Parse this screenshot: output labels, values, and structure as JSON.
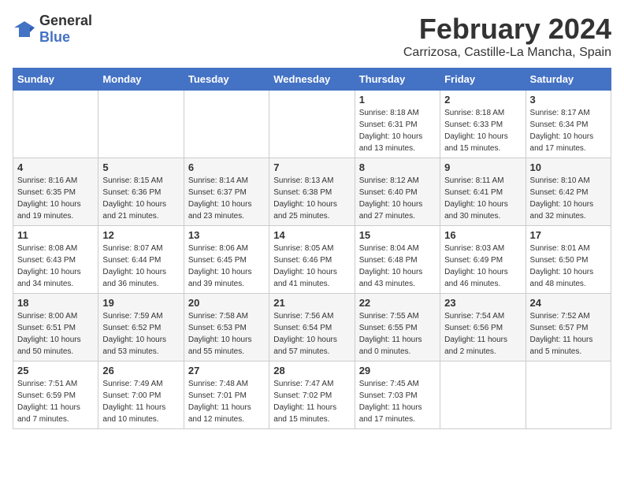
{
  "logo": {
    "text_general": "General",
    "text_blue": "Blue"
  },
  "title": "February 2024",
  "subtitle": "Carrizosa, Castille-La Mancha, Spain",
  "headers": [
    "Sunday",
    "Monday",
    "Tuesday",
    "Wednesday",
    "Thursday",
    "Friday",
    "Saturday"
  ],
  "weeks": [
    [
      {
        "day": "",
        "info": ""
      },
      {
        "day": "",
        "info": ""
      },
      {
        "day": "",
        "info": ""
      },
      {
        "day": "",
        "info": ""
      },
      {
        "day": "1",
        "info": "Sunrise: 8:18 AM\nSunset: 6:31 PM\nDaylight: 10 hours\nand 13 minutes."
      },
      {
        "day": "2",
        "info": "Sunrise: 8:18 AM\nSunset: 6:33 PM\nDaylight: 10 hours\nand 15 minutes."
      },
      {
        "day": "3",
        "info": "Sunrise: 8:17 AM\nSunset: 6:34 PM\nDaylight: 10 hours\nand 17 minutes."
      }
    ],
    [
      {
        "day": "4",
        "info": "Sunrise: 8:16 AM\nSunset: 6:35 PM\nDaylight: 10 hours\nand 19 minutes."
      },
      {
        "day": "5",
        "info": "Sunrise: 8:15 AM\nSunset: 6:36 PM\nDaylight: 10 hours\nand 21 minutes."
      },
      {
        "day": "6",
        "info": "Sunrise: 8:14 AM\nSunset: 6:37 PM\nDaylight: 10 hours\nand 23 minutes."
      },
      {
        "day": "7",
        "info": "Sunrise: 8:13 AM\nSunset: 6:38 PM\nDaylight: 10 hours\nand 25 minutes."
      },
      {
        "day": "8",
        "info": "Sunrise: 8:12 AM\nSunset: 6:40 PM\nDaylight: 10 hours\nand 27 minutes."
      },
      {
        "day": "9",
        "info": "Sunrise: 8:11 AM\nSunset: 6:41 PM\nDaylight: 10 hours\nand 30 minutes."
      },
      {
        "day": "10",
        "info": "Sunrise: 8:10 AM\nSunset: 6:42 PM\nDaylight: 10 hours\nand 32 minutes."
      }
    ],
    [
      {
        "day": "11",
        "info": "Sunrise: 8:08 AM\nSunset: 6:43 PM\nDaylight: 10 hours\nand 34 minutes."
      },
      {
        "day": "12",
        "info": "Sunrise: 8:07 AM\nSunset: 6:44 PM\nDaylight: 10 hours\nand 36 minutes."
      },
      {
        "day": "13",
        "info": "Sunrise: 8:06 AM\nSunset: 6:45 PM\nDaylight: 10 hours\nand 39 minutes."
      },
      {
        "day": "14",
        "info": "Sunrise: 8:05 AM\nSunset: 6:46 PM\nDaylight: 10 hours\nand 41 minutes."
      },
      {
        "day": "15",
        "info": "Sunrise: 8:04 AM\nSunset: 6:48 PM\nDaylight: 10 hours\nand 43 minutes."
      },
      {
        "day": "16",
        "info": "Sunrise: 8:03 AM\nSunset: 6:49 PM\nDaylight: 10 hours\nand 46 minutes."
      },
      {
        "day": "17",
        "info": "Sunrise: 8:01 AM\nSunset: 6:50 PM\nDaylight: 10 hours\nand 48 minutes."
      }
    ],
    [
      {
        "day": "18",
        "info": "Sunrise: 8:00 AM\nSunset: 6:51 PM\nDaylight: 10 hours\nand 50 minutes."
      },
      {
        "day": "19",
        "info": "Sunrise: 7:59 AM\nSunset: 6:52 PM\nDaylight: 10 hours\nand 53 minutes."
      },
      {
        "day": "20",
        "info": "Sunrise: 7:58 AM\nSunset: 6:53 PM\nDaylight: 10 hours\nand 55 minutes."
      },
      {
        "day": "21",
        "info": "Sunrise: 7:56 AM\nSunset: 6:54 PM\nDaylight: 10 hours\nand 57 minutes."
      },
      {
        "day": "22",
        "info": "Sunrise: 7:55 AM\nSunset: 6:55 PM\nDaylight: 11 hours\nand 0 minutes."
      },
      {
        "day": "23",
        "info": "Sunrise: 7:54 AM\nSunset: 6:56 PM\nDaylight: 11 hours\nand 2 minutes."
      },
      {
        "day": "24",
        "info": "Sunrise: 7:52 AM\nSunset: 6:57 PM\nDaylight: 11 hours\nand 5 minutes."
      }
    ],
    [
      {
        "day": "25",
        "info": "Sunrise: 7:51 AM\nSunset: 6:59 PM\nDaylight: 11 hours\nand 7 minutes."
      },
      {
        "day": "26",
        "info": "Sunrise: 7:49 AM\nSunset: 7:00 PM\nDaylight: 11 hours\nand 10 minutes."
      },
      {
        "day": "27",
        "info": "Sunrise: 7:48 AM\nSunset: 7:01 PM\nDaylight: 11 hours\nand 12 minutes."
      },
      {
        "day": "28",
        "info": "Sunrise: 7:47 AM\nSunset: 7:02 PM\nDaylight: 11 hours\nand 15 minutes."
      },
      {
        "day": "29",
        "info": "Sunrise: 7:45 AM\nSunset: 7:03 PM\nDaylight: 11 hours\nand 17 minutes."
      },
      {
        "day": "",
        "info": ""
      },
      {
        "day": "",
        "info": ""
      }
    ]
  ]
}
